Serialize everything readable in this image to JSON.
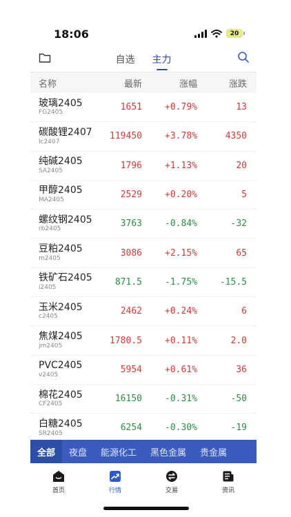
{
  "status_bar": {
    "time": "18:06",
    "battery": "20"
  },
  "top_nav": {
    "tabs": [
      {
        "label": "自选",
        "active": false
      },
      {
        "label": "主力",
        "active": true
      }
    ]
  },
  "table": {
    "headers": {
      "name": "名称",
      "last": "最新",
      "change_pct": "涨幅",
      "change": "涨跌"
    },
    "rows": [
      {
        "name": "玻璃2405",
        "code": "FG2405",
        "last": "1651",
        "pct": "+0.79%",
        "diff": "13",
        "dir": "up"
      },
      {
        "name": "碳酸锂2407",
        "code": "lc2407",
        "last": "119450",
        "pct": "+3.78%",
        "diff": "4350",
        "dir": "up"
      },
      {
        "name": "纯碱2405",
        "code": "SA2405",
        "last": "1796",
        "pct": "+1.13%",
        "diff": "20",
        "dir": "up"
      },
      {
        "name": "甲醇2405",
        "code": "MA2405",
        "last": "2529",
        "pct": "+0.20%",
        "diff": "5",
        "dir": "up"
      },
      {
        "name": "螺纹钢2405",
        "code": "rb2405",
        "last": "3763",
        "pct": "-0.84%",
        "diff": "-32",
        "dir": "down"
      },
      {
        "name": "豆粕2405",
        "code": "m2405",
        "last": "3086",
        "pct": "+2.15%",
        "diff": "65",
        "dir": "up"
      },
      {
        "name": "铁矿石2405",
        "code": "i2405",
        "last": "871.5",
        "pct": "-1.75%",
        "diff": "-15.5",
        "dir": "down"
      },
      {
        "name": "玉米2405",
        "code": "c2405",
        "last": "2462",
        "pct": "+0.24%",
        "diff": "6",
        "dir": "up"
      },
      {
        "name": "焦煤2405",
        "code": "jm2405",
        "last": "1780.5",
        "pct": "+0.11%",
        "diff": "2.0",
        "dir": "up"
      },
      {
        "name": "PVC2405",
        "code": "v2405",
        "last": "5954",
        "pct": "+0.61%",
        "diff": "36",
        "dir": "up"
      },
      {
        "name": "棉花2405",
        "code": "CF2405",
        "last": "16150",
        "pct": "-0.31%",
        "diff": "-50",
        "dir": "down"
      },
      {
        "name": "白糖2405",
        "code": "SR2405",
        "last": "6254",
        "pct": "-0.30%",
        "diff": "-19",
        "dir": "down"
      }
    ]
  },
  "categories": [
    {
      "label": "全部",
      "active": true
    },
    {
      "label": "夜盘",
      "active": false
    },
    {
      "label": "能源化工",
      "active": false
    },
    {
      "label": "黑色金属",
      "active": false
    },
    {
      "label": "贵金属",
      "active": false
    }
  ],
  "bottom_tabs": [
    {
      "label": "首页",
      "icon": "home-icon",
      "active": false
    },
    {
      "label": "行情",
      "icon": "chart-trend-icon",
      "active": true
    },
    {
      "label": "交易",
      "icon": "exchange-icon",
      "active": false
    },
    {
      "label": "资讯",
      "icon": "news-icon",
      "active": false
    }
  ],
  "colors": {
    "up": "#d03a3a",
    "down": "#2e8b47",
    "accent": "#2d4aa0",
    "category_bar": "#3b5bbd"
  }
}
